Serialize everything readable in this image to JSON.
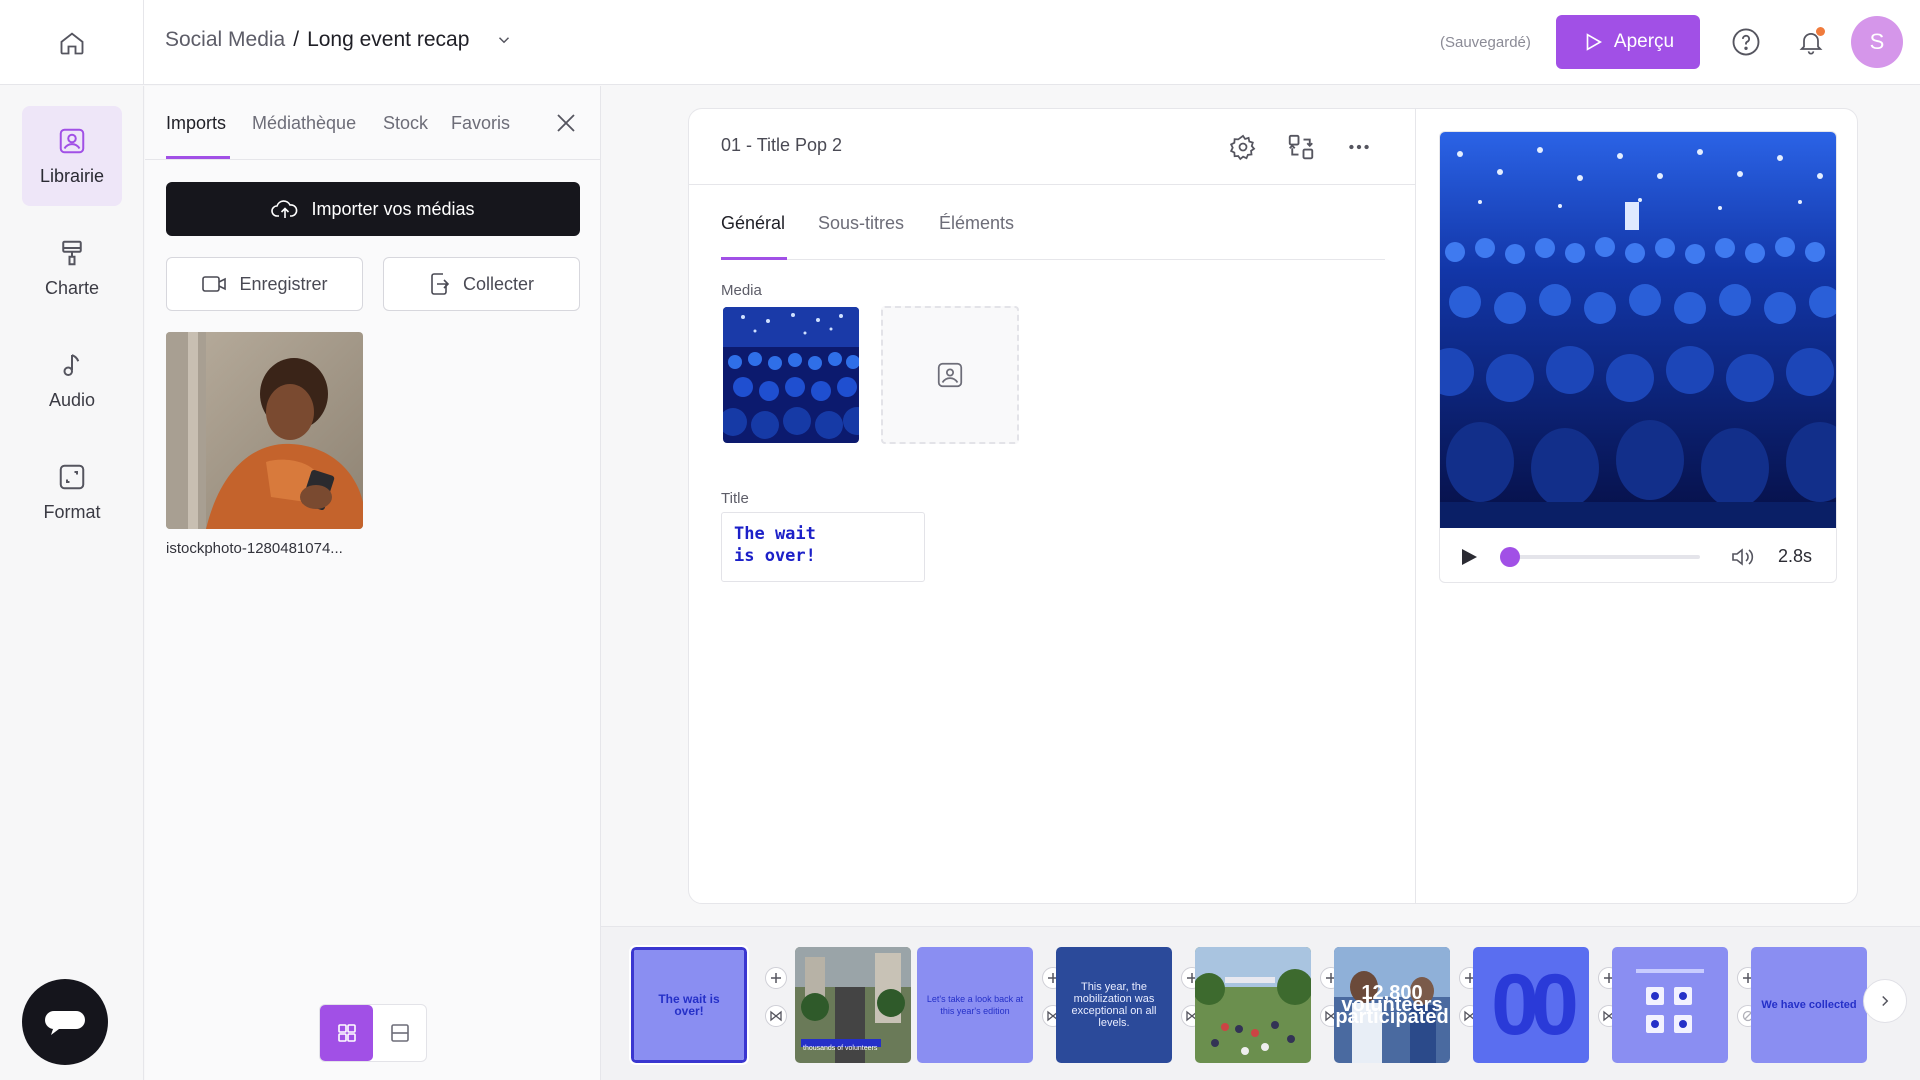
{
  "header": {
    "breadcrumb_parent": "Social Media",
    "breadcrumb_separator": "/",
    "breadcrumb_current": "Long event recap",
    "save_status": "(Sauvegardé)",
    "preview_label": "Aperçu",
    "avatar_initial": "S"
  },
  "sidebar": {
    "items": [
      {
        "label": "Librairie",
        "icon": "library-icon",
        "active": true
      },
      {
        "label": "Charte",
        "icon": "brush-icon"
      },
      {
        "label": "Audio",
        "icon": "music-note-icon"
      },
      {
        "label": "Format",
        "icon": "resize-icon"
      }
    ]
  },
  "library": {
    "tabs": [
      "Imports",
      "Médiathèque",
      "Stock",
      "Favoris"
    ],
    "import_label": "Importer vos médias",
    "record_label": "Enregistrer",
    "collect_label": "Collecter",
    "files": [
      {
        "name": "istockphoto-1280481074..."
      }
    ]
  },
  "editor": {
    "scene_title": "01 - Title Pop 2",
    "tabs": [
      "Général",
      "Sous-titres",
      "Éléments"
    ],
    "media_label": "Media",
    "title_label": "Title",
    "title_value": "The wait\nis over!"
  },
  "preview": {
    "duration": "2.8s",
    "progress": 0.0
  },
  "timeline": {
    "clips": [
      {
        "text": "The wait is over!",
        "style": "purple",
        "selected": true
      },
      {
        "text": "thousands of volunteers",
        "style": "photo-street"
      },
      {
        "text": "Let's take a look back at this year's edition",
        "style": "purple-light"
      },
      {
        "text": "This year, the mobilization was exceptional on all levels.",
        "style": "photo-blue"
      },
      {
        "text": "",
        "style": "photo-park"
      },
      {
        "text": "12,800 volunteers participated",
        "style": "photo-runner"
      },
      {
        "text": "00",
        "style": "blue-big"
      },
      {
        "text": "",
        "style": "purple-icons"
      },
      {
        "text": "We have collected",
        "style": "purple-text"
      }
    ]
  },
  "colors": {
    "accent": "#a150e6",
    "dark": "#16161c",
    "clip_purple": "#8a8ef2",
    "clip_blue": "#2530c8"
  }
}
